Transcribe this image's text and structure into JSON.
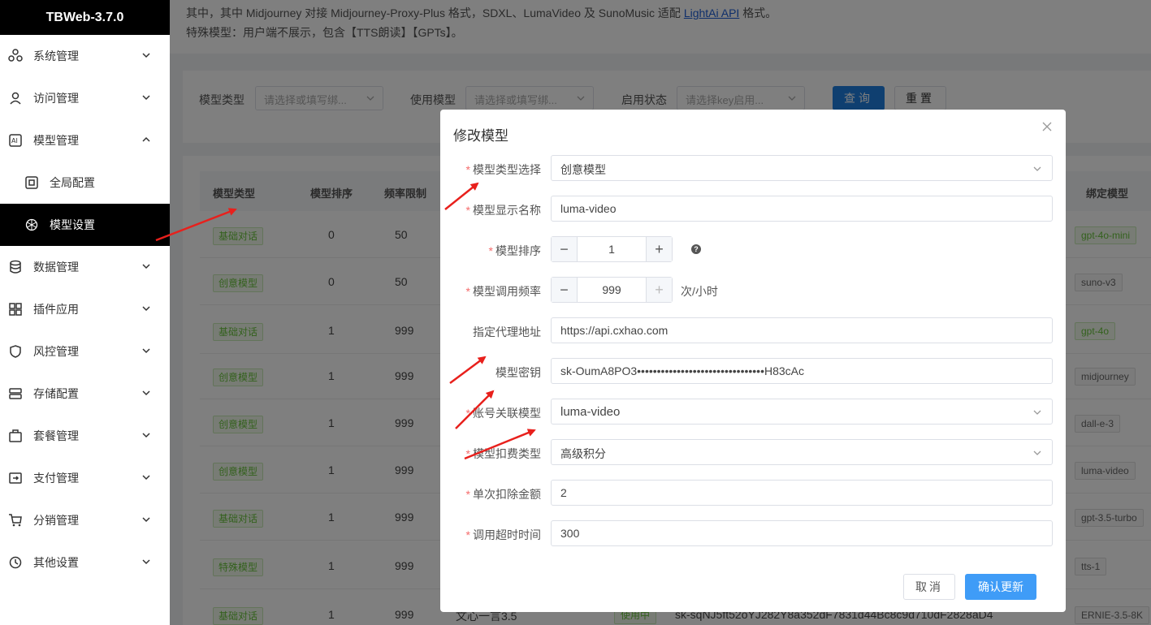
{
  "sidebar": {
    "brand": "TBWeb-3.7.0",
    "items": [
      {
        "label": "系统管理",
        "icon": "system-icon"
      },
      {
        "label": "访问管理",
        "icon": "user-icon"
      },
      {
        "label": "模型管理",
        "icon": "ai-icon"
      },
      {
        "label": "全局配置",
        "icon": "config-icon"
      },
      {
        "label": "模型设置",
        "icon": "openai-icon"
      },
      {
        "label": "数据管理",
        "icon": "database-icon"
      },
      {
        "label": "插件应用",
        "icon": "apps-icon"
      },
      {
        "label": "风控管理",
        "icon": "shield-icon"
      },
      {
        "label": "存储配置",
        "icon": "storage-icon"
      },
      {
        "label": "套餐管理",
        "icon": "package-icon"
      },
      {
        "label": "支付管理",
        "icon": "payment-icon"
      },
      {
        "label": "分销管理",
        "icon": "cart-icon"
      },
      {
        "label": "其他设置",
        "icon": "history-icon"
      }
    ]
  },
  "notice": {
    "line1_pre": "其中，其中 Midjourney 对接 Midjourney-Proxy-Plus 格式，SDXL、LumaVideo 及 SunoMusic 适配 ",
    "line1_link": "LightAi API",
    "line1_post": " 格式。",
    "line2": "特殊模型：用户端不展示，包含【TTS朗读】【GPTs】。"
  },
  "filters": {
    "model_type_label": "模型类型",
    "model_type_placeholder": "请选择或填写绑...",
    "use_model_label": "使用模型",
    "use_model_placeholder": "请选择或填写绑...",
    "status_label": "启用状态",
    "status_placeholder": "请选择key启用...",
    "search_button": "查询",
    "reset_button": "重置"
  },
  "table": {
    "headers": {
      "type": "模型类型",
      "order": "模型排序",
      "freq": "频率限制",
      "bind": "绑定模型"
    },
    "rows": [
      {
        "type": "基础对话",
        "order": "0",
        "freq": "50",
        "bind": "gpt-4o-mini",
        "bind_green": true
      },
      {
        "type": "创意模型",
        "order": "0",
        "freq": "50",
        "bind": "suno-v3",
        "bind_green": false
      },
      {
        "type": "基础对话",
        "order": "1",
        "freq": "999",
        "bind": "gpt-4o",
        "bind_green": true
      },
      {
        "type": "创意模型",
        "order": "1",
        "freq": "999",
        "bind": "midjourney",
        "bind_green": false
      },
      {
        "type": "创意模型",
        "order": "1",
        "freq": "999",
        "bind": "dall-e-3",
        "bind_green": false
      },
      {
        "type": "创意模型",
        "order": "1",
        "freq": "999",
        "bind": "luma-video",
        "bind_green": false
      },
      {
        "type": "基础对话",
        "order": "1",
        "freq": "999",
        "bind": "gpt-3.5-turbo",
        "bind_green": false
      },
      {
        "type": "特殊模型",
        "order": "1",
        "freq": "999",
        "bind": "tts-1",
        "bind_green": false
      },
      {
        "type": "基础对话",
        "order": "1",
        "freq": "999",
        "name": "文心一言3.5",
        "status": "使用中",
        "key": "sk-sqNJ5ft52oYJ282Y8a352dF7831d44Bc8c9d710dF2828aD4",
        "bind": "ERNIE-3.5-8K",
        "bind_green": false
      }
    ]
  },
  "modal": {
    "title": "修改模型",
    "fields": {
      "type_label": "模型类型选择",
      "type_value": "创意模型",
      "name_label": "模型显示名称",
      "name_value": "luma-video",
      "order_label": "模型排序",
      "order_value": "1",
      "freq_label": "模型调用频率",
      "freq_value": "999",
      "freq_unit": "次/小时",
      "proxy_label": "指定代理地址",
      "proxy_value": "https://api.cxhao.com",
      "key_label": "模型密钥",
      "key_value": "sk-OumA8PO3••••••••••••••••••••••••••••••••H83cAc",
      "account_label": "账号关联模型",
      "account_value": "luma-video",
      "billing_label": "模型扣费类型",
      "billing_value": "高级积分",
      "deduct_label": "单次扣除金额",
      "deduct_value": "2",
      "timeout_label": "调用超时时间",
      "timeout_value": "300"
    },
    "cancel_button": "取消",
    "confirm_button": "确认更新"
  },
  "colors": {
    "annotation_arrow": "#e8201c",
    "primary": "#1e7fe1",
    "required": "#f56c6c"
  }
}
